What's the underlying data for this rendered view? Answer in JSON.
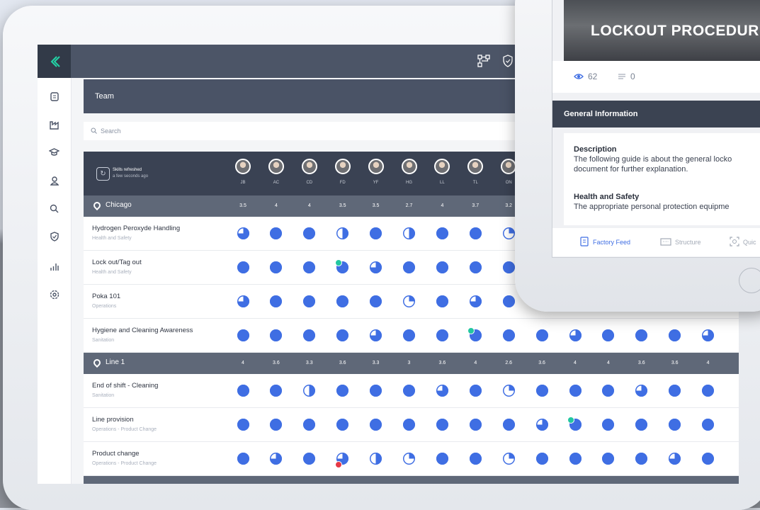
{
  "team_title": "Team",
  "search_placeholder": "Search",
  "refresh": {
    "line1": "Skills refreshed",
    "line2": "a few seconds ago"
  },
  "people": [
    "JB",
    "AC",
    "CD",
    "FD",
    "YF",
    "HG",
    "LL",
    "TL",
    "ON"
  ],
  "groups": [
    {
      "name": "Chicago",
      "scores": [
        "3.5",
        "4",
        "4",
        "3.5",
        "3.5",
        "2.7",
        "4",
        "3.7",
        "3.2"
      ],
      "rows": [
        {
          "title": "Hydrogen Peroxyde Handling",
          "category": "Health and Safety",
          "levels": [
            0.75,
            1,
            1,
            0.5,
            1,
            0.5,
            1,
            1,
            0.25
          ],
          "badges": []
        },
        {
          "title": "Lock out/Tag out",
          "category": "Health and Safety",
          "levels": [
            1,
            1,
            1,
            1,
            0.75,
            1,
            1,
            1,
            1
          ],
          "badges": [
            {
              "col": 3,
              "type": "check"
            }
          ]
        },
        {
          "title": "Poka 101",
          "category": "Operations",
          "levels": [
            0.75,
            1,
            1,
            1,
            1,
            0.25,
            1,
            0.75,
            1
          ],
          "badges": []
        },
        {
          "title": "Hygiene and Cleaning Awareness",
          "category": "Sanitation",
          "levels": [
            1,
            1,
            1,
            1,
            0.75,
            1,
            1,
            1,
            1,
            1,
            0.75,
            1,
            1,
            1,
            0.75
          ],
          "badges": [
            {
              "col": 7,
              "type": "check"
            }
          ]
        }
      ]
    },
    {
      "name": "Line 1",
      "scores": [
        "4",
        "3.6",
        "3.3",
        "3.6",
        "3.3",
        "3",
        "3.6",
        "4",
        "2.6",
        "3.6",
        "4",
        "4",
        "3.6",
        "3.6",
        "4"
      ],
      "rows": [
        {
          "title": "End of shift - Cleaning",
          "category": "Sanitation",
          "levels": [
            1,
            1,
            0.5,
            1,
            1,
            1,
            0.75,
            1,
            0.25,
            1,
            1,
            1,
            0.75,
            1,
            1
          ],
          "badges": []
        },
        {
          "title": "Line provision",
          "category": "Operations - Product Change",
          "levels": [
            1,
            1,
            1,
            1,
            1,
            1,
            1,
            1,
            1,
            0.75,
            1,
            1,
            1,
            1,
            1
          ],
          "badges": [
            {
              "col": 10,
              "type": "check"
            }
          ]
        },
        {
          "title": "Product change",
          "category": "Operations - Product Change",
          "levels": [
            1,
            0.75,
            1,
            0.75,
            0.5,
            0.25,
            1,
            1,
            0.25,
            1,
            1,
            1,
            1,
            0.75,
            1
          ],
          "badges": [
            {
              "col": 3,
              "type": "alert"
            }
          ]
        }
      ]
    }
  ],
  "phone": {
    "video_title": "LOCKOUT PROCEDUR",
    "views": "62",
    "comments": "0",
    "section_title": "General Information",
    "description_label": "Description",
    "description_text_1": "The following guide is about the general locko",
    "description_text_2": "document for further explanation.",
    "health_label": "Health and Safety",
    "health_text": "The appropriate personal protection equipme",
    "tabs": [
      "Factory Feed",
      "Structure",
      "Quic"
    ]
  },
  "colors": {
    "dot": "#3f6ee3",
    "check": "#23c7a0",
    "alert": "#e63946",
    "accent": "#23d3a6"
  }
}
